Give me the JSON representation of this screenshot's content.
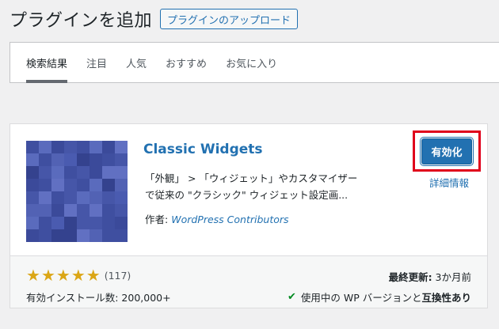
{
  "header": {
    "title": "プラグインを追加",
    "upload_button": "プラグインのアップロード"
  },
  "filter_tabs": [
    {
      "label": "検索結果",
      "current": true
    },
    {
      "label": "注目",
      "current": false
    },
    {
      "label": "人気",
      "current": false
    },
    {
      "label": "おすすめ",
      "current": false
    },
    {
      "label": "お気に入り",
      "current": false
    }
  ],
  "plugin": {
    "name": "Classic Widgets",
    "description_line1": "「外観」 > 「ウィジェット」やカスタマイザー",
    "description_line2": "で従来の \"クラシック\" ウィジェット設定画...",
    "author_label": "作者:",
    "author": "WordPress Contributors",
    "activate_button": "有効化",
    "details_link": "詳細情報",
    "rating_stars": 5,
    "rating_count": "(117)",
    "installs": "有効インストール数: 200,000+",
    "last_updated_label": "最終更新:",
    "last_updated_value": "3か月前",
    "compat_text": "使用中の WP バージョンと",
    "compat_bold": "互換性あり"
  },
  "icons": {
    "plugin_icon": "classic-widgets-pixel-pattern",
    "star": "star-icon",
    "compat": "checkmark-icon"
  },
  "colors": {
    "accent": "#2271b1",
    "highlight": "#e0001b",
    "star": "#dba617",
    "check": "#008a20"
  }
}
